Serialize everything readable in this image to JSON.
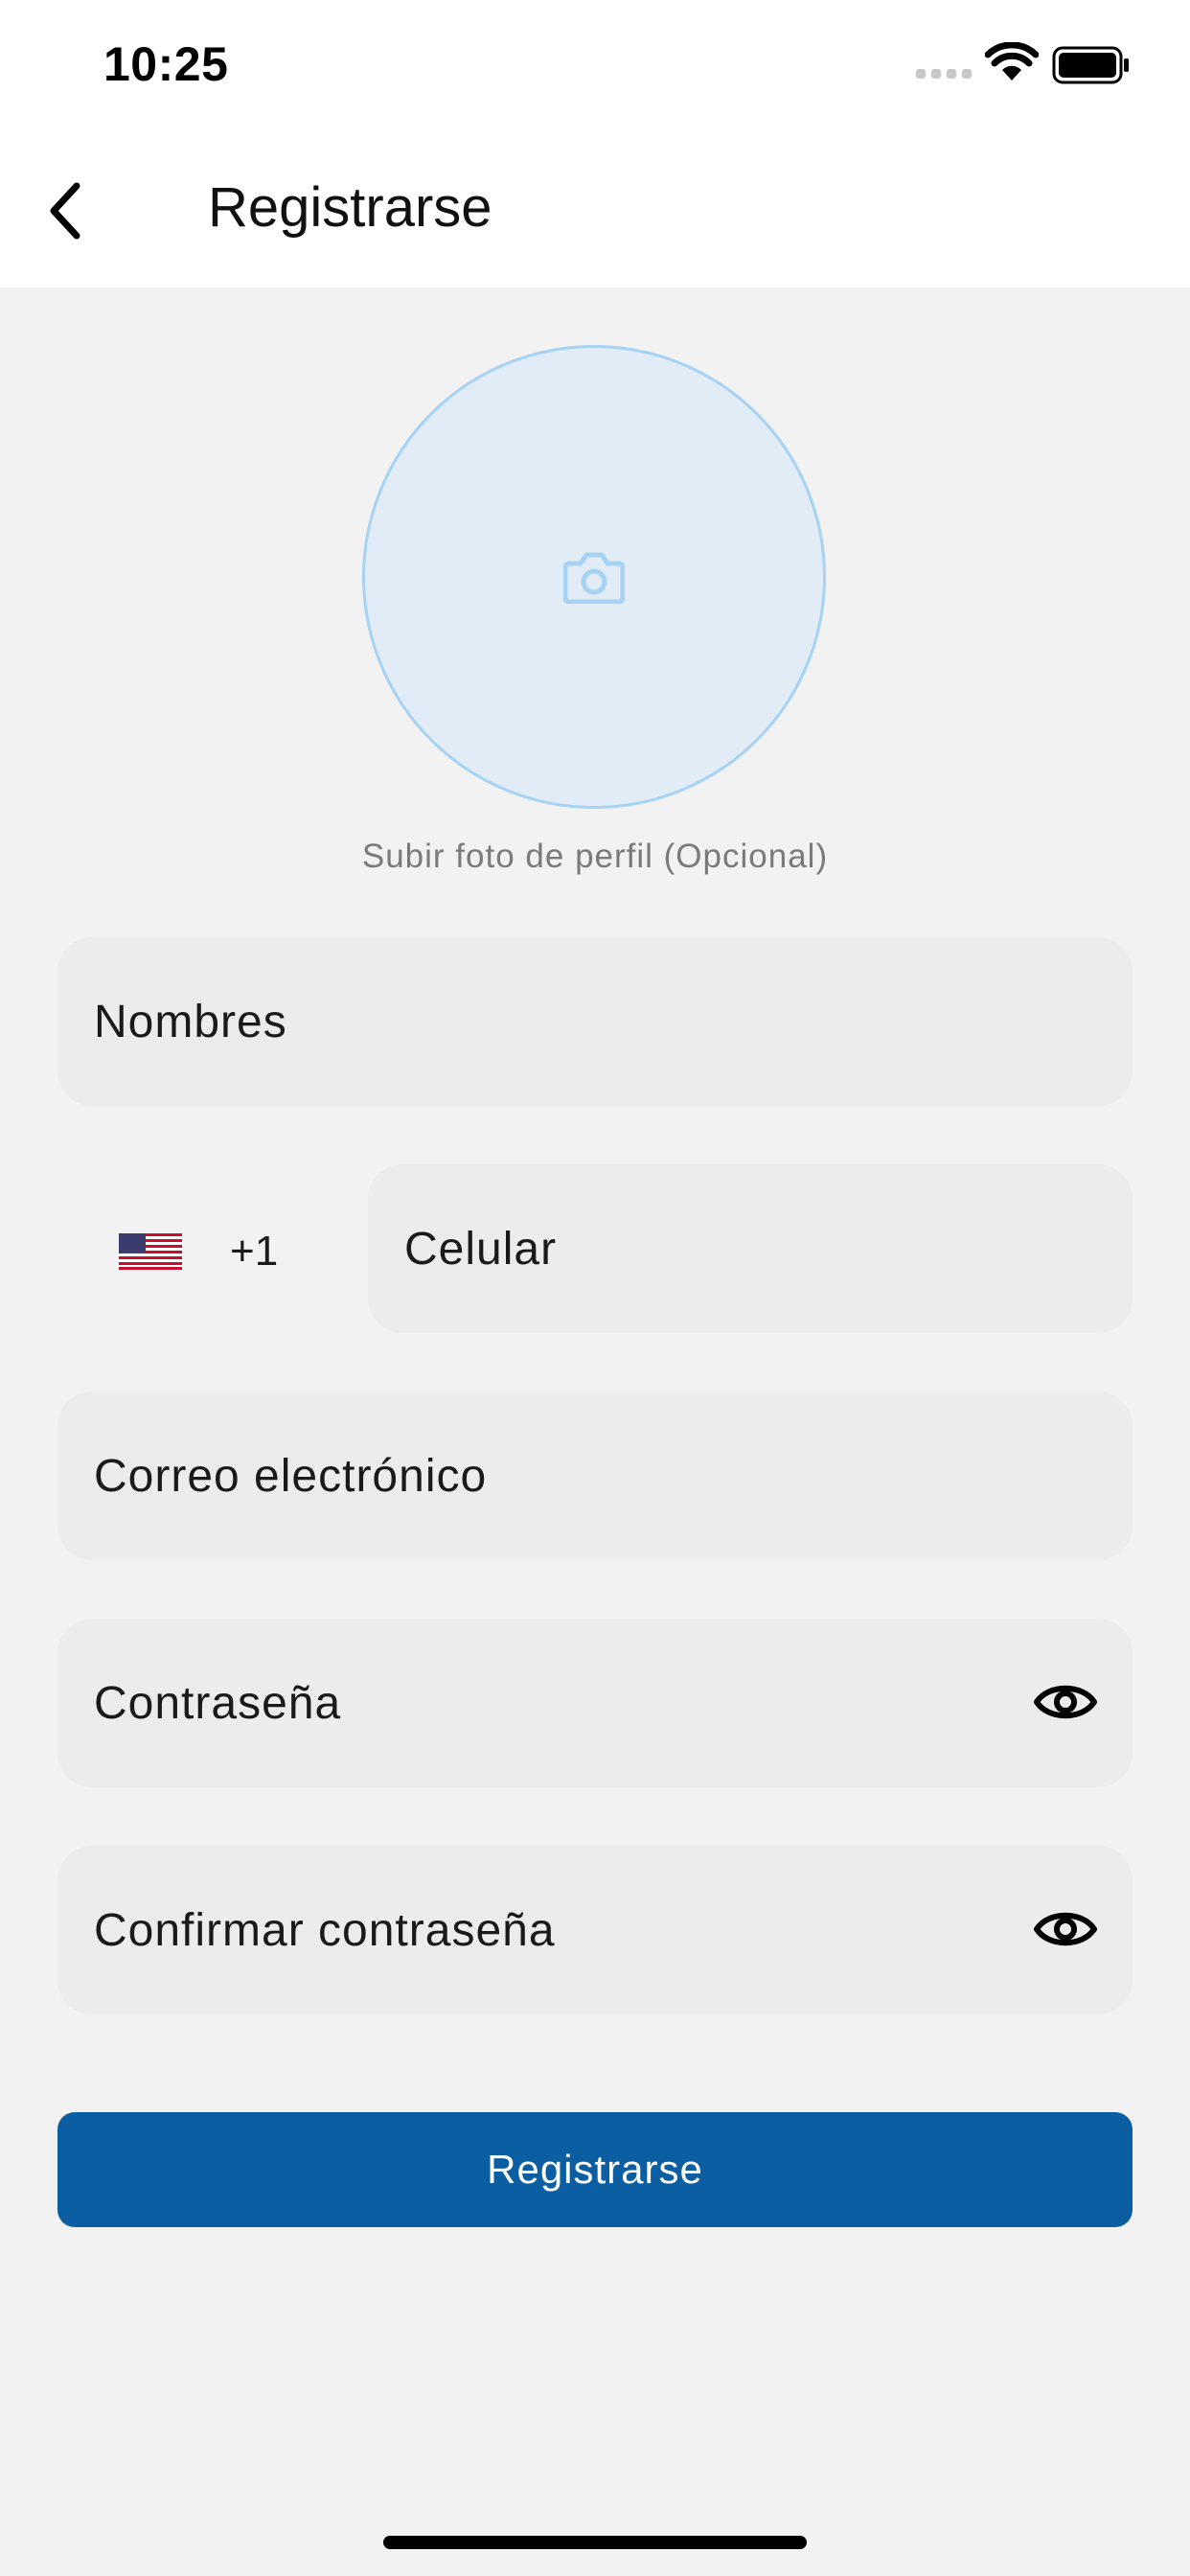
{
  "status_bar": {
    "time": "10:25"
  },
  "header": {
    "title": "Registrarse"
  },
  "avatar": {
    "caption": "Subir foto de perfil (Opcional)"
  },
  "form": {
    "name_placeholder": "Nombres",
    "country_code": "+1",
    "phone_placeholder": "Celular",
    "email_placeholder": "Correo electrónico",
    "password_placeholder": "Contraseña",
    "confirm_password_placeholder": "Confirmar contraseña"
  },
  "submit": {
    "label": "Registrarse"
  },
  "colors": {
    "accent": "#0a5ea1",
    "field_bg": "#ececec",
    "avatar_bg": "#e2ecf6",
    "avatar_border": "#a6d3f3"
  },
  "icons": [
    "back-chevron-icon",
    "camera-icon",
    "us-flag-icon",
    "eye-icon",
    "wifi-icon",
    "battery-icon",
    "cellular-signal-icon"
  ]
}
